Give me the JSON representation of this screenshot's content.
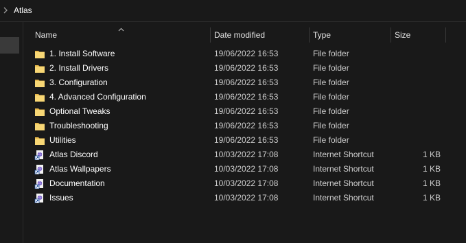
{
  "address": {
    "chevron_icon": "chevron-right-icon",
    "current_folder": "Atlas"
  },
  "columns": {
    "name": "Name",
    "date_modified": "Date modified",
    "type": "Type",
    "size": "Size",
    "sort_icon": "sort-ascending-icon"
  },
  "items": [
    {
      "name": "1. Install Software",
      "date": "19/06/2022 16:53",
      "type": "File folder",
      "size": "",
      "icon": "folder-icon"
    },
    {
      "name": "2. Install Drivers",
      "date": "19/06/2022 16:53",
      "type": "File folder",
      "size": "",
      "icon": "folder-icon"
    },
    {
      "name": "3. Configuration",
      "date": "19/06/2022 16:53",
      "type": "File folder",
      "size": "",
      "icon": "folder-icon"
    },
    {
      "name": "4. Advanced Configuration",
      "date": "19/06/2022 16:53",
      "type": "File folder",
      "size": "",
      "icon": "folder-icon"
    },
    {
      "name": "Optional Tweaks",
      "date": "19/06/2022 16:53",
      "type": "File folder",
      "size": "",
      "icon": "folder-icon"
    },
    {
      "name": "Troubleshooting",
      "date": "19/06/2022 16:53",
      "type": "File folder",
      "size": "",
      "icon": "folder-icon"
    },
    {
      "name": "Utilities",
      "date": "19/06/2022 16:53",
      "type": "File folder",
      "size": "",
      "icon": "folder-icon"
    },
    {
      "name": "Atlas Discord",
      "date": "10/03/2022 17:08",
      "type": "Internet Shortcut",
      "size": "1 KB",
      "icon": "internet-shortcut-icon"
    },
    {
      "name": "Atlas Wallpapers",
      "date": "10/03/2022 17:08",
      "type": "Internet Shortcut",
      "size": "1 KB",
      "icon": "internet-shortcut-icon"
    },
    {
      "name": "Documentation",
      "date": "10/03/2022 17:08",
      "type": "Internet Shortcut",
      "size": "1 KB",
      "icon": "internet-shortcut-icon"
    },
    {
      "name": "Issues",
      "date": "10/03/2022 17:08",
      "type": "Internet Shortcut",
      "size": "1 KB",
      "icon": "internet-shortcut-icon"
    }
  ],
  "colors": {
    "background": "#191919",
    "folder": "#f8d775",
    "selected": "#3a3a3a"
  }
}
